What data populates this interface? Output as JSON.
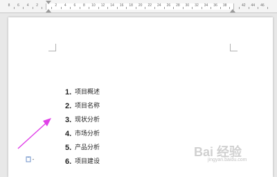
{
  "ruler": {
    "numbers": [
      "8",
      "6",
      "4",
      "2",
      "",
      "2",
      "4",
      "6",
      "8",
      "10",
      "12",
      "14",
      "16",
      "18",
      "20",
      "22",
      "24",
      "26",
      "28",
      "30",
      "32",
      "34",
      "36",
      "38",
      "",
      "42",
      "44",
      "46"
    ]
  },
  "document": {
    "items": [
      {
        "num": "1.",
        "text": "项目概述"
      },
      {
        "num": "2.",
        "text": "项目名称"
      },
      {
        "num": "3.",
        "text": "现状分析"
      },
      {
        "num": "4.",
        "text": "市场分析"
      },
      {
        "num": "5.",
        "text": "产品分析"
      },
      {
        "num": "6.",
        "text": "项目建设"
      }
    ]
  },
  "annotation": {
    "color": "#e040e8"
  },
  "watermark": {
    "logo": "Bai 经验",
    "sub": "jingyan.baidu.com"
  }
}
